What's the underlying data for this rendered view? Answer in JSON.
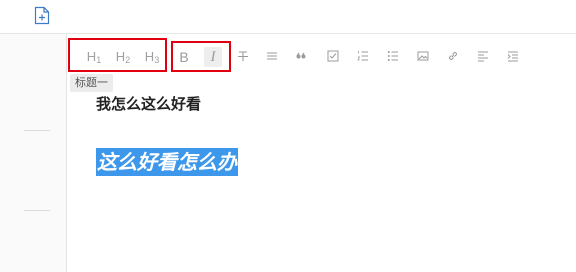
{
  "toolbar": {
    "heading_group": [
      {
        "label": "H",
        "sub": "1",
        "name": "heading-1-button"
      },
      {
        "label": "H",
        "sub": "2",
        "name": "heading-2-button"
      },
      {
        "label": "H",
        "sub": "3",
        "name": "heading-3-button"
      }
    ],
    "format_group": [
      {
        "label": "B",
        "name": "bold-button"
      },
      {
        "label": "I",
        "name": "italic-button"
      }
    ],
    "icons": [
      "strikethrough-icon",
      "horizontal-rule-icon",
      "quote-icon",
      "checkbox-icon",
      "ordered-list-icon",
      "unordered-list-icon",
      "image-icon",
      "link-icon",
      "align-left-icon",
      "indent-icon"
    ]
  },
  "tooltip": "标题一",
  "document": {
    "heading_line": "我怎么这么好看",
    "selected_line": "这么好看怎么办"
  },
  "colors": {
    "selection": "#3d97ea",
    "highlight_box": "#e0000f",
    "toolbar_icon": "#9b9b9b"
  }
}
